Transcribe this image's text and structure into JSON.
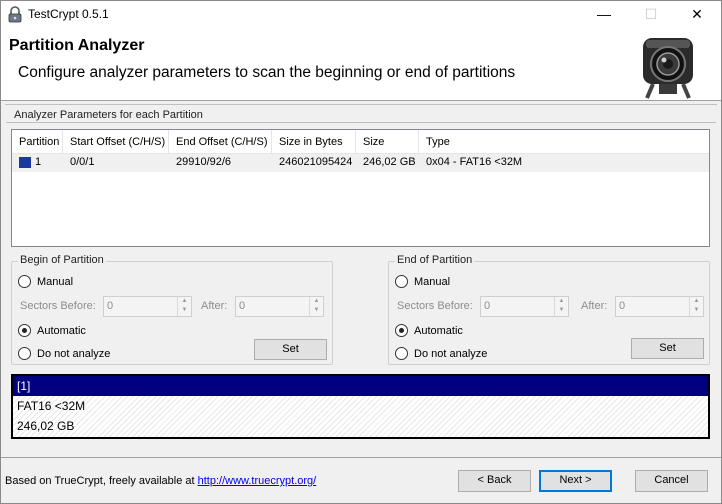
{
  "window": {
    "title": "TestCrypt 0.5.1",
    "controls": {
      "minimize": "—",
      "maximize": "☐",
      "close": "✕"
    }
  },
  "header": {
    "title": "Partition Analyzer",
    "subtitle": "Configure analyzer parameters to scan the beginning or end of partitions"
  },
  "analyzer_group": {
    "label": "Analyzer Parameters for each Partition"
  },
  "partition_table": {
    "columns": [
      "Partition",
      "Start Offset (C/H/S)",
      "End Offset (C/H/S)",
      "Size in Bytes",
      "Size",
      "Type"
    ],
    "rows": [
      {
        "partition": "1",
        "start": "0/0/1",
        "end": "29910/92/6",
        "bytes": "246021095424",
        "size": "246,02 GB",
        "type": "0x04 - FAT16 <32M",
        "swatch_color": "#1a3b9e"
      }
    ]
  },
  "begin": {
    "label": "Begin of Partition",
    "manual": "Manual",
    "sectors_before_label": "Sectors Before:",
    "sectors_before": "0",
    "after_label": "After:",
    "after": "0",
    "automatic": "Automatic",
    "do_not_analyze": "Do not analyze",
    "selected": "automatic",
    "set_label": "Set"
  },
  "end": {
    "label": "End of Partition",
    "manual": "Manual",
    "sectors_before_label": "Sectors Before:",
    "sectors_before": "0",
    "after_label": "After:",
    "after": "0",
    "automatic": "Automatic",
    "do_not_analyze": "Do not analyze",
    "selected": "automatic",
    "set_label": "Set"
  },
  "info_list": {
    "items": [
      "[1]",
      "FAT16 <32M",
      "246,02 GB"
    ],
    "selected_index": 0,
    "selected_color": "#000080"
  },
  "footer": {
    "text": "Based on TrueCrypt, freely available at ",
    "link": "http://www.truecrypt.org/",
    "back_label": "< Back",
    "next_label": "Next >",
    "cancel_label": "Cancel"
  }
}
